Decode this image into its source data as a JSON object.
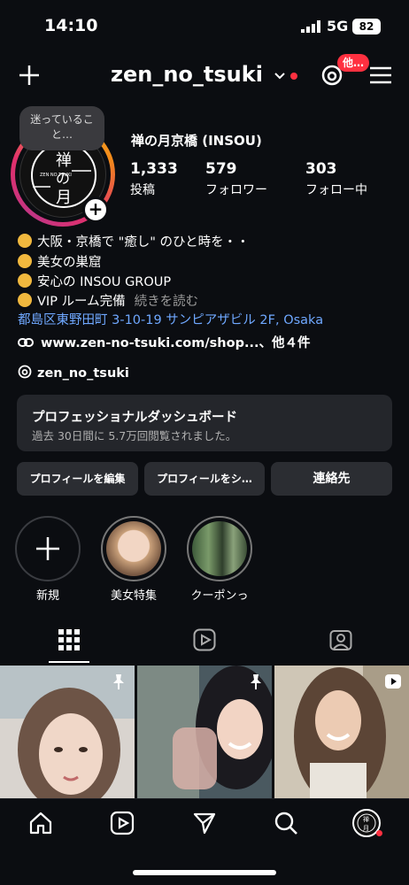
{
  "status": {
    "time": "14:10",
    "network": "5G",
    "battery": "82"
  },
  "header": {
    "username": "zen_no_tsuki",
    "threads_badge": "他…"
  },
  "profile": {
    "note": "迷っていること…",
    "avatar_text": [
      "禅",
      "の",
      "月"
    ],
    "avatar_sub": "ZEN NO TSUKI",
    "display_name": "禅の月京橋 (INSOU)",
    "stats": [
      {
        "value": "1,333",
        "label": "投稿"
      },
      {
        "value": "579",
        "label": "フォロワー"
      },
      {
        "value": "303",
        "label": "フォロー中"
      }
    ],
    "bio": [
      "大阪・京橋で \"癒し\" のひと時を・・",
      "美女の巣窟",
      "安心の INSOU GROUP",
      "VIP ルーム完備"
    ],
    "bio_more": "続きを読む",
    "address": "都島区東野田町 3-10-19 サンピアザビル 2F, Osaka",
    "link": "www.zen-no-tsuki.com/shop...、他４件",
    "threads_handle": "zen_no_tsuki"
  },
  "dashboard": {
    "title": "プロフェッショナルダッシュボード",
    "subtitle": "過去 30日間に 5.7万回閲覧されました。"
  },
  "buttons": {
    "edit": "プロフィールを編集",
    "share": "プロフィールをシ…",
    "contact": "連絡先"
  },
  "highlights": [
    {
      "label": "新規"
    },
    {
      "label": "美女特集"
    },
    {
      "label": "クーポンっ"
    }
  ],
  "colors": {
    "accent_link": "#6fa8ff",
    "badge_red": "#ff3040",
    "panel": "#24262b"
  }
}
